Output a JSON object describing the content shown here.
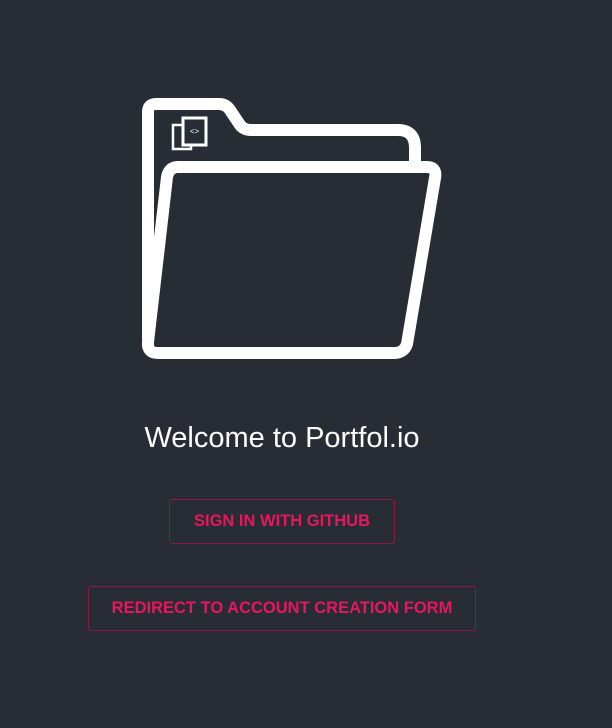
{
  "app": {
    "welcome_text": "Welcome to Portfol.io",
    "logo_icon": "folder-code-icon"
  },
  "actions": {
    "github_label": "SIGN IN WITH GITHUB",
    "redirect_label": "REDIRECT TO ACCOUNT CREATION FORM"
  },
  "colors": {
    "background": "#272c35",
    "accent": "#e8175d",
    "border": "#8a1c40",
    "text": "#ffffff"
  }
}
